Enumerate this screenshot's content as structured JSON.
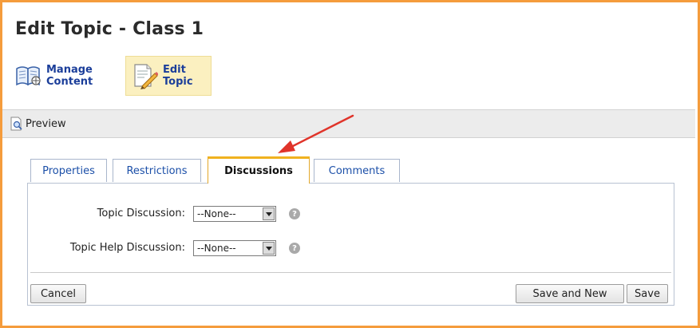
{
  "page": {
    "title": "Edit Topic - Class 1"
  },
  "nav": {
    "manage_content": {
      "label": "Manage\nContent",
      "icon": "book-icon"
    },
    "edit_topic": {
      "label": "Edit\nTopic",
      "icon": "pencil-document-icon",
      "active": true
    }
  },
  "toolbar": {
    "preview_label": "Preview"
  },
  "tabs": [
    {
      "label": "Properties",
      "active": false
    },
    {
      "label": "Restrictions",
      "active": false
    },
    {
      "label": "Discussions",
      "active": true
    },
    {
      "label": "Comments",
      "active": false
    }
  ],
  "form": {
    "topic_discussion": {
      "label": "Topic Discussion:",
      "value": "--None--"
    },
    "topic_help_discussion": {
      "label": "Topic Help Discussion:",
      "value": "--None--"
    }
  },
  "buttons": {
    "cancel": "Cancel",
    "save_and_new": "Save and New",
    "save": "Save"
  },
  "colors": {
    "frame_border": "#f59c3c",
    "link_blue": "#1b3e9a",
    "active_tab_accent": "#f0b21f",
    "annotation_arrow": "#e0342a"
  }
}
